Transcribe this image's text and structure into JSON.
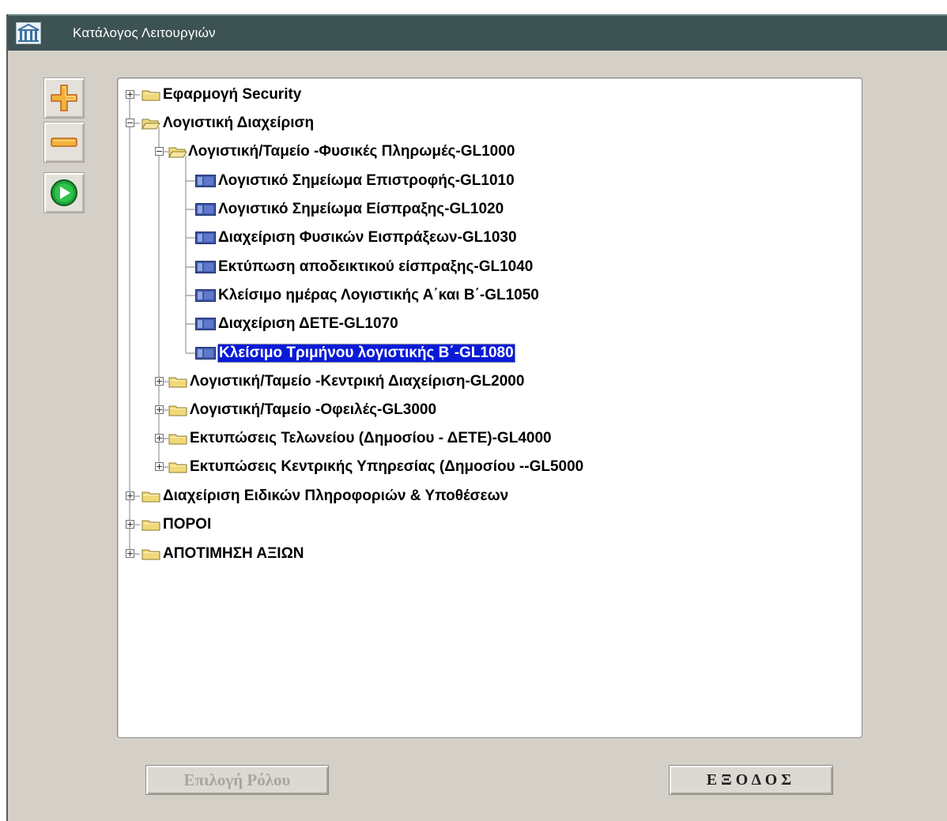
{
  "window": {
    "title": "Κατάλογος Λειτουργιών",
    "icon": "building-columns-icon"
  },
  "toolbar": {
    "expand": {
      "icon": "plus-icon"
    },
    "collapse": {
      "icon": "minus-icon"
    },
    "run": {
      "icon": "play-icon"
    }
  },
  "tree": {
    "nodes": [
      {
        "label": "Εφαρμογή Security",
        "type": "folder",
        "state": "collapsed",
        "level": 0
      },
      {
        "label": "Λογιστική Διαχείριση",
        "type": "folder",
        "state": "expanded",
        "level": 0
      },
      {
        "label": "Λογιστική/Ταμείο -Φυσικές Πληρωμές-GL1000",
        "type": "folder",
        "state": "expanded",
        "level": 1
      },
      {
        "label": "Λογιστικό Σημείωμα Επιστροφής-GL1010",
        "type": "function",
        "level": 2
      },
      {
        "label": "Λογιστικό Σημείωμα Είσπραξης-GL1020",
        "type": "function",
        "level": 2
      },
      {
        "label": "Διαχείριση Φυσικών Εισπράξεων-GL1030",
        "type": "function",
        "level": 2
      },
      {
        "label": "Εκτύπωση αποδεικτικού είσπραξης-GL1040",
        "type": "function",
        "level": 2
      },
      {
        "label": "Κλείσιμο ημέρας Λογιστικής Α΄και Β΄-GL1050",
        "type": "function",
        "level": 2
      },
      {
        "label": "Διαχείριση ΔΕΤΕ-GL1070",
        "type": "function",
        "level": 2
      },
      {
        "label": "Κλείσιμο Τριμήνου λογιστικής Β΄-GL1080",
        "type": "function",
        "level": 2,
        "selected": true
      },
      {
        "label": "Λογιστική/Ταμείο -Κεντρική Διαχείριση-GL2000",
        "type": "folder",
        "state": "collapsed",
        "level": 1
      },
      {
        "label": "Λογιστική/Ταμείο -Οφειλές-GL3000",
        "type": "folder",
        "state": "collapsed",
        "level": 1
      },
      {
        "label": "Εκτυπώσεις  Τελωνείου (Δημοσίου - ΔΕΤΕ)-GL4000",
        "type": "folder",
        "state": "collapsed",
        "level": 1
      },
      {
        "label": "Εκτυπώσεις  Κεντρικής Υπηρεσίας (Δημοσίου --GL5000",
        "type": "folder",
        "state": "collapsed",
        "level": 1
      },
      {
        "label": "Διαχείριση Ειδικών Πληροφοριών & Υποθέσεων",
        "type": "folder",
        "state": "collapsed",
        "level": 0
      },
      {
        "label": "ΠΟΡΟΙ",
        "type": "folder",
        "state": "collapsed",
        "level": 0
      },
      {
        "label": "ΑΠΟΤΙΜΗΣΗ ΑΞΙΩΝ",
        "type": "folder",
        "state": "collapsed",
        "level": 0
      }
    ]
  },
  "footer": {
    "role_button": {
      "label": "Επιλογή Ρόλου",
      "enabled": false
    },
    "exit_button": {
      "label": "ΕΞΟΔΟΣ"
    }
  },
  "colors": {
    "titlebar": "#3d5252",
    "selection": "#0a1bd8",
    "folder": "#f1d97a",
    "window_bg": "#d4d0c8"
  }
}
